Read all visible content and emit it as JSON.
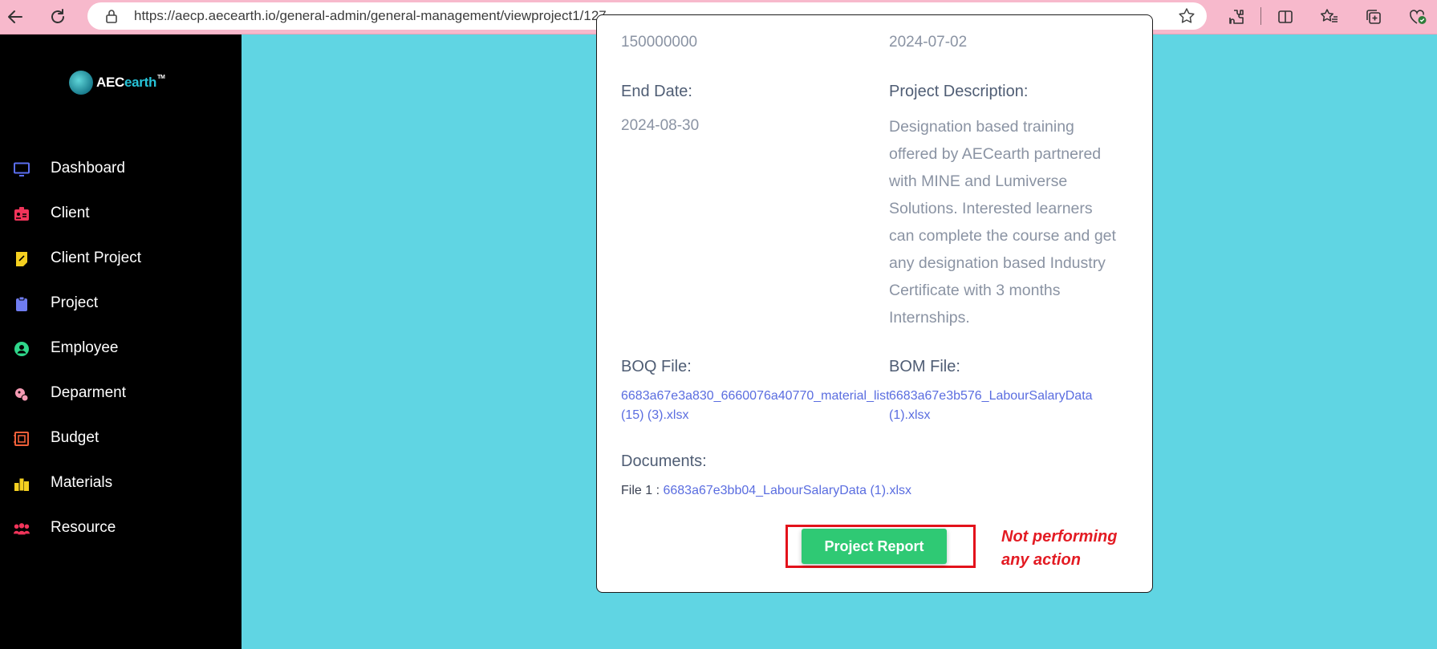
{
  "browser": {
    "url": "https://aecp.aecearth.io/general-admin/general-management/viewproject1/127"
  },
  "sidebar": {
    "logo": {
      "prefix": "AEC",
      "accent": "earth",
      "tm": "TM"
    },
    "items": [
      {
        "label": "Dashboard",
        "icon": "monitor-icon",
        "color": "#5b6ef0"
      },
      {
        "label": "Client",
        "icon": "id-card-icon",
        "color": "#f0345a"
      },
      {
        "label": "Client Project",
        "icon": "sticky-note-icon",
        "color": "#f5d020"
      },
      {
        "label": "Project",
        "icon": "clipboard-icon",
        "color": "#6f7cf0"
      },
      {
        "label": "Employee",
        "icon": "user-circle-icon",
        "color": "#2fd68a"
      },
      {
        "label": "Deparment",
        "icon": "department-icon",
        "color": "#f59ab3"
      },
      {
        "label": "Budget",
        "icon": "budget-icon",
        "color": "#f0603a"
      },
      {
        "label": "Materials",
        "icon": "materials-icon",
        "color": "#f5d020"
      },
      {
        "label": "Resource",
        "icon": "people-group-icon",
        "color": "#f0345a"
      }
    ]
  },
  "project": {
    "budget_value": "150000000",
    "start_date_value": "2024-07-02",
    "end_date_label": "End Date:",
    "end_date_value": "2024-08-30",
    "description_label": "Project Description:",
    "description_lines": [
      "Designation based training",
      "offered by AECearth partnered",
      "with MINE and Lumiverse",
      "Solutions. Interested learners",
      "can complete the course and get",
      "any designation based Industry",
      "Certificate with 3 months",
      "Internships."
    ],
    "boq_label": "BOQ File:",
    "boq_file_line1": "6683a67e3a830_6660076a40770_material_list",
    "boq_file_line2": "(15) (3).xlsx",
    "bom_label": "BOM File:",
    "bom_file_line1": "6683a67e3b576_LabourSalaryData",
    "bom_file_line2": "(1).xlsx",
    "documents_label": "Documents:",
    "documents": [
      {
        "prefix": "File 1 : ",
        "name": "6683a67e3bb04_LabourSalaryData (1).xlsx"
      }
    ],
    "report_button": "Project Report"
  },
  "annotation": {
    "line1": "Not performing",
    "line2": "any action",
    "color": "#e31b23"
  },
  "colors": {
    "page_bg": "#60d5e3",
    "sidebar_bg": "#000000",
    "browser_bar": "#f7b9cc",
    "button": "#2fc974",
    "link": "#5a6de0"
  }
}
